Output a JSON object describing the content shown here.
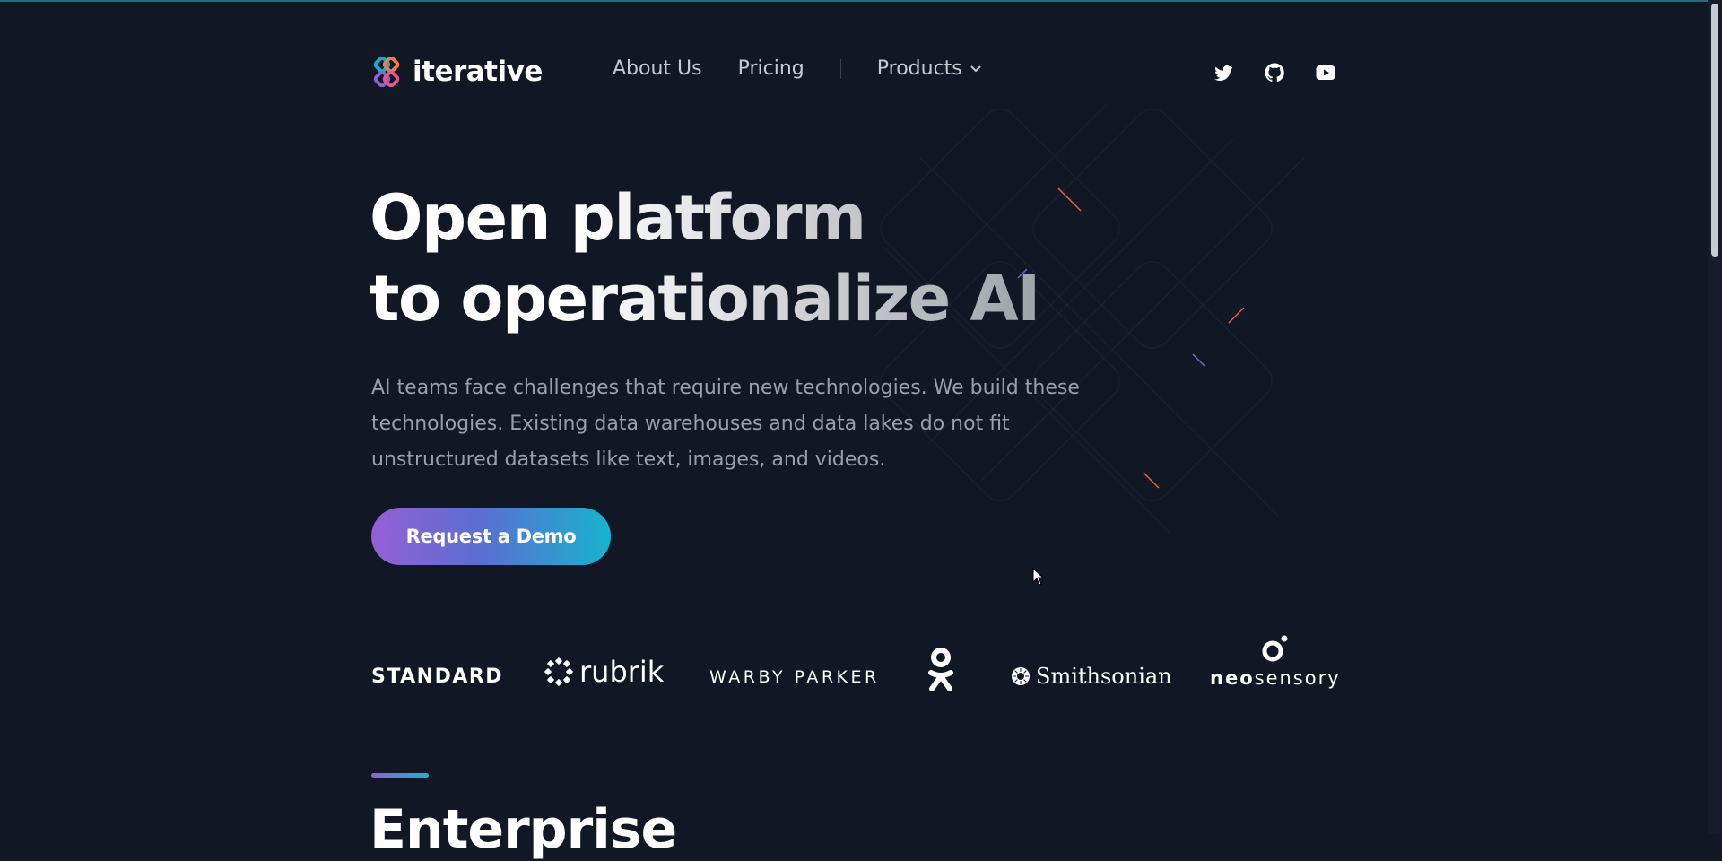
{
  "header": {
    "brand": "iterative",
    "nav": {
      "about_label": "About Us",
      "pricing_label": "Pricing",
      "products_label": "Products"
    },
    "social_icons": [
      "twitter-icon",
      "github-icon",
      "youtube-icon"
    ]
  },
  "hero": {
    "headline_line1": "Open platform",
    "headline_line2": "to operationalize AI",
    "lead": "AI teams face challenges that require new technologies. We build these technologies. Existing data warehouses and data lakes do not fit unstructured datasets like text, images, and videos.",
    "cta_label": "Request a Demo"
  },
  "customers": {
    "standard": "STANDARD",
    "rubrik": "rubrik",
    "warby": "WARBY PARKER",
    "smithsonian": "Smithsonian",
    "neo_bold": "neo",
    "neo_rest": "sensory"
  },
  "section": {
    "title": "Enterprise"
  },
  "colors": {
    "background": "#111724",
    "gradient_start": "#9460d6",
    "gradient_end": "#18b3cf",
    "text_muted": "#9aa0ab"
  }
}
